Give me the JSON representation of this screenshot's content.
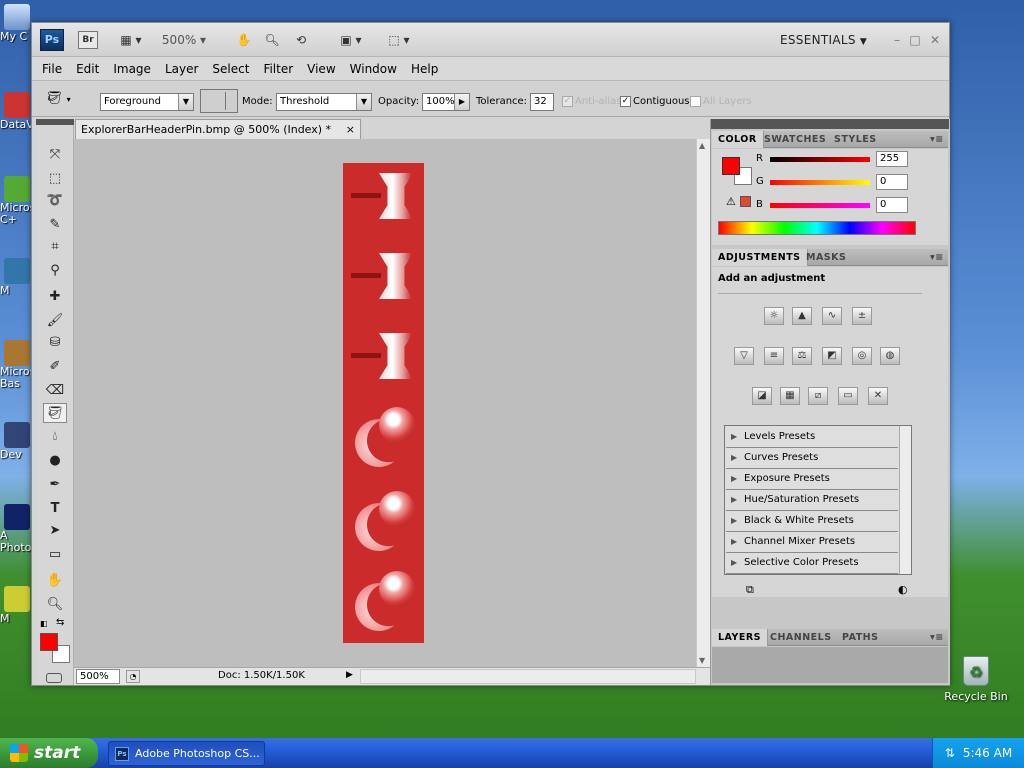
{
  "desktop": {
    "icons": [
      {
        "label": "My C"
      },
      {
        "label": "DataV"
      },
      {
        "label": "Micros C+"
      },
      {
        "label": "M"
      },
      {
        "label": "Micros Bas"
      },
      {
        "label": "Dev"
      },
      {
        "label": "A Photo"
      },
      {
        "label": "M"
      }
    ],
    "recycle_bin": "Recycle Bin"
  },
  "taskbar": {
    "start_label": "start",
    "task_label": "Adobe Photoshop CS...",
    "clock": "5:46 AM"
  },
  "appbar": {
    "ps_logo": "Ps",
    "br_logo": "Br",
    "zoom": "500%",
    "workspace": "ESSENTIALS",
    "min": "–",
    "max": "□",
    "close": "✕"
  },
  "menu": [
    "File",
    "Edit",
    "Image",
    "Layer",
    "Select",
    "Filter",
    "View",
    "Window",
    "Help"
  ],
  "options": {
    "fill_source": "Foreground",
    "mode_label": "Mode:",
    "mode_value": "Threshold",
    "opacity_label": "Opacity:",
    "opacity_value": "100%",
    "tolerance_label": "Tolerance:",
    "tolerance_value": "32",
    "antialias_label": "Anti-alias",
    "contiguous_label": "Contiguous",
    "all_layers_label": "All Layers",
    "contiguous_checked": "✓"
  },
  "document": {
    "tab_title": "ExplorerBarHeaderPin.bmp @ 500% (Index) *",
    "tab_close": "×",
    "zoom_status": "500%",
    "doc_info": "Doc: 1.50K/1.50K"
  },
  "tools": [
    "move-tool",
    "marquee-tool",
    "lasso-tool",
    "quick-select-tool",
    "crop-tool",
    "eyedropper-tool",
    "healing-brush-tool",
    "brush-tool",
    "clone-stamp-tool",
    "history-brush-tool",
    "eraser-tool",
    "paint-bucket-tool",
    "blur-tool",
    "dodge-tool",
    "pen-tool",
    "type-tool",
    "path-select-tool",
    "shape-tool",
    "hand-tool",
    "zoom-tool"
  ],
  "colors": {
    "foreground": "#ff0000",
    "background": "#ffffff",
    "image_red": "#cc2b2b"
  },
  "color_panel": {
    "tabs": [
      "COLOR",
      "SWATCHES",
      "STYLES"
    ],
    "r_label": "R",
    "g_label": "G",
    "b_label": "B",
    "r_value": "255",
    "g_value": "0",
    "b_value": "0"
  },
  "adjustments_panel": {
    "tabs": [
      "ADJUSTMENTS",
      "MASKS"
    ],
    "heading": "Add an adjustment",
    "presets": [
      "Levels Presets",
      "Curves Presets",
      "Exposure Presets",
      "Hue/Saturation Presets",
      "Black & White Presets",
      "Channel Mixer Presets",
      "Selective Color Presets"
    ]
  },
  "layers_panel": {
    "tabs": [
      "LAYERS",
      "CHANNELS",
      "PATHS"
    ]
  }
}
